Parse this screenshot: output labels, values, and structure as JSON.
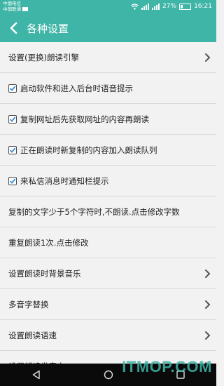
{
  "status_bar": {
    "carrier_1": "中国电信",
    "carrier_2": "中国联通",
    "battery": "27%",
    "time": "16:21"
  },
  "app_bar": {
    "title": "各种设置"
  },
  "settings": [
    {
      "type": "nav",
      "label": "设置(更换)朗读引擎"
    },
    {
      "type": "check",
      "label": "启动软件和进入后台时语音提示",
      "checked": true
    },
    {
      "type": "check",
      "label": "复制网址后先获取网址的内容再朗读",
      "checked": true
    },
    {
      "type": "check",
      "label": "正在朗读时新复制的内容加入朗读队列",
      "checked": true
    },
    {
      "type": "check",
      "label": "来私信消息时通知栏提示",
      "checked": true
    },
    {
      "type": "text",
      "label": "复制的文字少于5个字符时,不朗读.点击修改字数"
    },
    {
      "type": "text",
      "label": "重复朗读1次.点击修改"
    },
    {
      "type": "nav",
      "label": "设置朗读时背景音乐"
    },
    {
      "type": "nav",
      "label": "多音字替换"
    },
    {
      "type": "nav",
      "label": "设置朗读语速"
    },
    {
      "type": "nav",
      "label": "设置朗读发音人"
    }
  ],
  "watermark": "ITMOP.COM",
  "colors": {
    "accent": "#3fb5a7",
    "navbar": "#0a0a0a",
    "background": "#f2f2f2"
  }
}
